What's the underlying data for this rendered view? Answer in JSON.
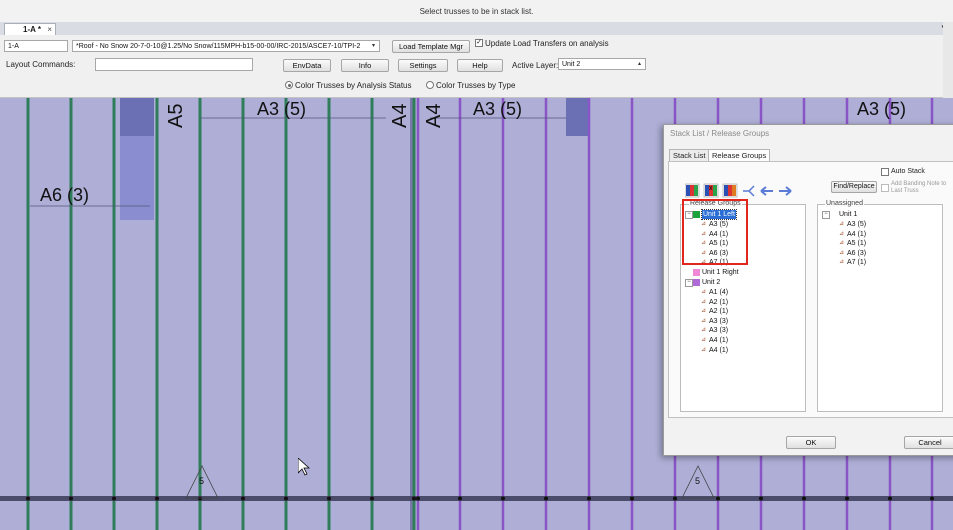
{
  "status": {
    "message": "Select trusses to be in stack list."
  },
  "tab": {
    "label": "1-A *",
    "close": "×",
    "dropdown": "▾"
  },
  "toolbar": {
    "layer_code": "1-A",
    "template": "*Roof - No Snow 20-7-0-10@1.25/No Snow/115MPH-b15-00-00/IRC-2015/ASCE7-10/TPI-2",
    "load_template_btn": "Load Template Mgr",
    "update_load_label": "Update Load Transfers on analysis",
    "layout_commands_label": "Layout Commands:",
    "layout_commands_value": "",
    "envdata_btn": "EnvData",
    "info_btn": "Info",
    "settings_btn": "Settings",
    "help_btn": "Help",
    "active_layer_label": "Active Layer:",
    "active_layer_value": "Unit 2",
    "radio_status_label": "Color Trusses by Analysis Status",
    "radio_type_label": "Color Trusses by Type"
  },
  "canvas": {
    "labels": [
      "A5",
      "A3 (5)",
      "A4",
      "A4",
      "A3 (5)",
      "A3 (5)",
      "A6 (3)",
      "5",
      "5"
    ],
    "colors": {
      "background": "#aeaed6",
      "green_truss": "#2f7d5a",
      "purple_truss": "#8a55c7",
      "dark_block": "#6b70b5"
    }
  },
  "dialog": {
    "title": "Stack List / Release Groups",
    "tab_stack": "Stack List",
    "tab_release": "Release Groups",
    "auto_stack": "Auto Stack",
    "add_banding": "Add Banding Note to Last Truss",
    "find_replace_btn": "Find/Replace",
    "release_groups_label": "Release Groups",
    "unassigned_label": "Unassigned",
    "ok_btn": "OK",
    "cancel_btn": "Cancel",
    "release_groups": [
      {
        "name": "Unit 1 Left",
        "color": "#1aa33a",
        "selected": true,
        "trusses": [
          "A3 (5)",
          "A4 (1)",
          "A5 (1)",
          "A6 (3)",
          "A7 (1)"
        ]
      },
      {
        "name": "Unit 1 Right",
        "color": "#f08ad8",
        "selected": false,
        "trusses": []
      },
      {
        "name": "Unit 2",
        "color": "#b06ad8",
        "selected": false,
        "trusses": [
          "A1 (4)",
          "A2 (1)",
          "A2 (1)",
          "A3 (3)",
          "A3 (3)",
          "A4 (1)",
          "A4 (1)"
        ]
      }
    ],
    "unassigned": [
      {
        "name": "Unit 1",
        "trusses": [
          "A3 (5)",
          "A4 (1)",
          "A5 (1)",
          "A6 (3)",
          "A7 (1)"
        ]
      }
    ]
  }
}
